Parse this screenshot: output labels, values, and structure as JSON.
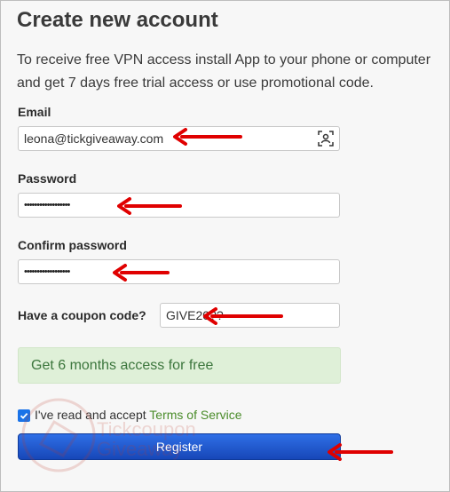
{
  "form": {
    "title": "Create new account",
    "intro": "To receive free VPN access install App to your phone or computer and get 7 days free trial access or use promotional code.",
    "email_label": "Email",
    "email_value": "leona@tickgiveaway.com",
    "password_label": "Password",
    "password_value": "••••••••••••••••••",
    "confirm_label": "Confirm password",
    "confirm_value": "••••••••••••••••••",
    "coupon_label": "Have a coupon code?",
    "coupon_value": "GIVE20??",
    "promo_message": "Get 6 months access for free",
    "accept_text": "I've read and accept",
    "terms_link": "Terms of Service",
    "register_label": "Register"
  },
  "watermark": {
    "line1": "Tickcoupon",
    "line2": "Giveaway"
  },
  "colors": {
    "arrow": "#e00000",
    "promo_bg": "#dff0d8",
    "promo_text": "#3c763d",
    "button": "#1f5bd1",
    "link": "#4a8c2a"
  },
  "icons": {
    "email_field": "contact-card-icon",
    "annotation": "red-arrow-icon"
  }
}
